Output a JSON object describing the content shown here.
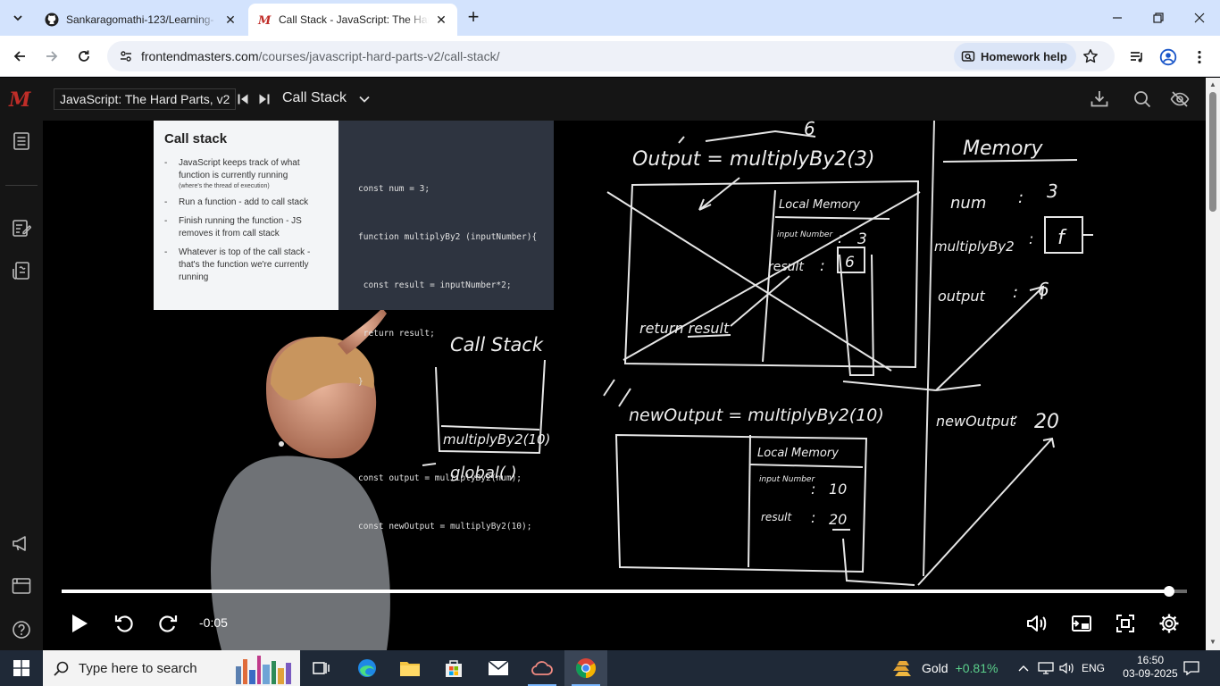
{
  "browser": {
    "tabs": [
      {
        "title": "Sankaragomathi-123/Learning-",
        "favicon": "github-icon",
        "active": false
      },
      {
        "title": "Call Stack - JavaScript: The Hard",
        "favicon": "frontendmasters-icon",
        "active": true
      }
    ],
    "url_host": "frontendmasters.com",
    "url_path": "/courses/javascript-hard-parts-v2/call-stack/",
    "homework_help_label": "Homework help"
  },
  "header": {
    "course": "JavaScript: The Hard Parts, v2",
    "lesson": "Call Stack"
  },
  "slide": {
    "title": "Call stack",
    "bullets": [
      {
        "text": "JavaScript keeps track of what function is currently running",
        "note": "(where's the thread of execution)"
      },
      {
        "text": "Run a function - add to call stack",
        "note": ""
      },
      {
        "text": "Finish running the function - JS removes it from call stack",
        "note": ""
      },
      {
        "text": "Whatever is top of the call stack - that's the function we're currently running",
        "note": ""
      }
    ],
    "code": [
      "const num = 3;",
      "function multiplyBy2 (inputNumber){",
      " const result = inputNumber*2;",
      " return result;",
      "}",
      "",
      "const output = multiplyBy2(num);",
      "const newOutput = multiplyBy2(10);"
    ]
  },
  "whiteboard": {
    "output_line": "Output = multiplyBy2(3)",
    "output_value_note": "6",
    "local_memory_label": "Local Memory",
    "input_number_label": "input Number",
    "input_number_value": "3",
    "result_label": "result",
    "result_value": "6",
    "return_line": "return result",
    "call_stack_label": "Call Stack",
    "stack_frames": [
      "multiplyBy2(10)",
      "global( )"
    ],
    "memory_label": "Memory",
    "memory": [
      {
        "key": "num",
        "value": "3"
      },
      {
        "key": "multiplyBy2",
        "value": "f"
      },
      {
        "key": "output",
        "value": "6"
      },
      {
        "key": "newOutput",
        "value": "20"
      }
    ],
    "new_output_line": "newOutput = multiplyBy2(10)",
    "local_memory2_label": "Local Memory",
    "input_number2_label": "input Number",
    "input_number2_value": "10",
    "result2_label": "result",
    "result2_value": "20"
  },
  "player": {
    "time_remaining": "-0:05",
    "progress_fraction": 0.984
  },
  "taskbar": {
    "search_placeholder": "Type here to search",
    "stock_name": "Gold",
    "stock_change": "+0.81%",
    "language": "ENG",
    "time": "16:50",
    "date": "03-09-2025"
  },
  "colors": {
    "brand_red": "#c02d28",
    "header_bg": "#151515",
    "stock_green": "#5bd08b"
  }
}
